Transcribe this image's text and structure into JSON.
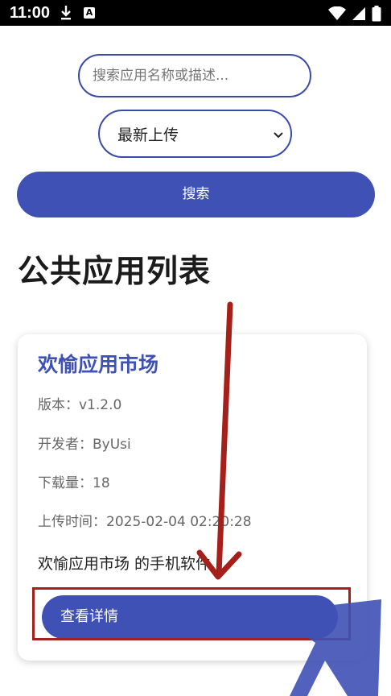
{
  "status_bar": {
    "time": "11:00"
  },
  "search": {
    "placeholder": "搜索应用名称或描述..."
  },
  "sort": {
    "selected": "最新上传"
  },
  "search_button": {
    "label": "搜索"
  },
  "section_title": "公共应用列表",
  "app_card": {
    "name": "欢愉应用市场",
    "version": "版本：v1.2.0",
    "developer": "开发者：ByUsi",
    "downloads": "下载量：18",
    "upload_time": "上传时间：2025-02-04 02:20:28",
    "description": "欢愉应用市场 的手机软件",
    "detail_button": "查看详情"
  },
  "colors": {
    "accent": "#3f51b5",
    "annotation": "#a5201b"
  }
}
